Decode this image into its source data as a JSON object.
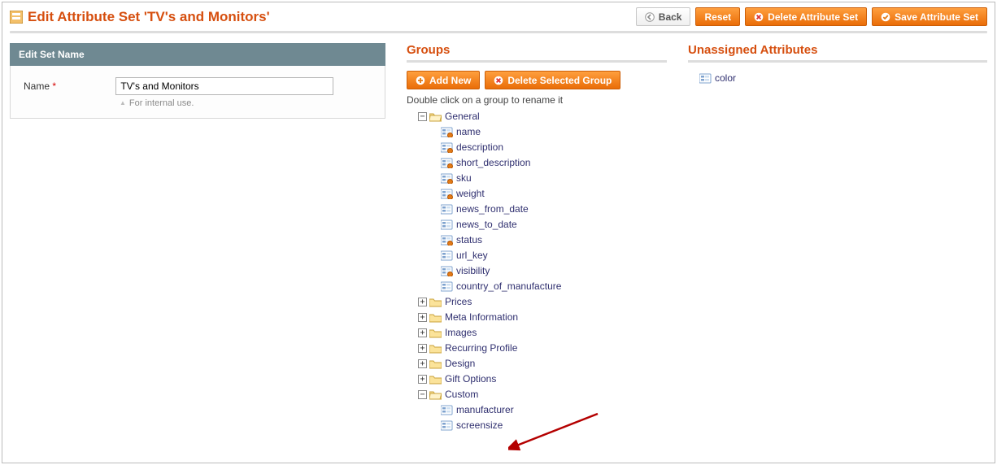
{
  "header": {
    "title": "Edit Attribute Set 'TV's and Monitors'",
    "back": "Back",
    "reset": "Reset",
    "delete": "Delete Attribute Set",
    "save": "Save Attribute Set"
  },
  "edit_panel": {
    "heading": "Edit Set Name",
    "name_label": "Name",
    "name_value": "TV's and Monitors",
    "hint": "For internal use."
  },
  "groups": {
    "title": "Groups",
    "add_new": "Add New",
    "delete_selected": "Delete Selected Group",
    "hint": "Double click on a group to rename it",
    "tree": [
      {
        "type": "folder",
        "expanded": true,
        "label": "General",
        "children": [
          {
            "label": "name",
            "sys": true
          },
          {
            "label": "description",
            "sys": true
          },
          {
            "label": "short_description",
            "sys": true
          },
          {
            "label": "sku",
            "sys": true
          },
          {
            "label": "weight",
            "sys": true
          },
          {
            "label": "news_from_date",
            "sys": false
          },
          {
            "label": "news_to_date",
            "sys": false
          },
          {
            "label": "status",
            "sys": true
          },
          {
            "label": "url_key",
            "sys": false
          },
          {
            "label": "visibility",
            "sys": true
          },
          {
            "label": "country_of_manufacture",
            "sys": false
          }
        ]
      },
      {
        "type": "folder",
        "expanded": false,
        "label": "Prices"
      },
      {
        "type": "folder",
        "expanded": false,
        "label": "Meta Information"
      },
      {
        "type": "folder",
        "expanded": false,
        "label": "Images"
      },
      {
        "type": "folder",
        "expanded": false,
        "label": "Recurring Profile"
      },
      {
        "type": "folder",
        "expanded": false,
        "label": "Design"
      },
      {
        "type": "folder",
        "expanded": false,
        "label": "Gift Options"
      },
      {
        "type": "folder",
        "expanded": true,
        "label": "Custom",
        "children": [
          {
            "label": "manufacturer",
            "sys": false
          },
          {
            "label": "screensize",
            "sys": false
          }
        ]
      }
    ]
  },
  "unassigned": {
    "title": "Unassigned Attributes",
    "items": [
      {
        "label": "color",
        "sys": false
      }
    ]
  }
}
